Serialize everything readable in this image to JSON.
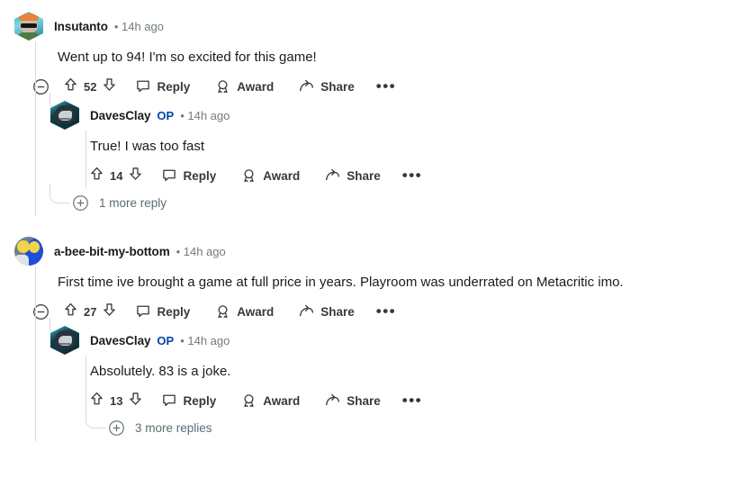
{
  "page": {
    "title": "Reddit comment thread",
    "accent_blue": "#0045ac",
    "text_color": "#181c1f",
    "meta_color": "#707b7f",
    "rail_color": "#d8dadc"
  },
  "labels": {
    "reply": "Reply",
    "award": "Award",
    "share": "Share",
    "more_dots": "•••"
  },
  "icons": {
    "collapse": "minus-circle-icon",
    "upvote": "upvote-arrow-icon",
    "downvote": "downvote-arrow-icon",
    "reply": "comment-bubble-icon",
    "award": "award-medal-icon",
    "share": "share-arrow-icon",
    "expand": "plus-circle-icon",
    "overflow": "overflow-menu-icon"
  },
  "comments": [
    {
      "id": "c1",
      "username": "Insutanto",
      "is_op": false,
      "op_label": "",
      "timestamp": "• 14h ago",
      "avatar": "dog-sunglasses-hex-avatar",
      "body": "Went up to 94! I'm so excited for this game!",
      "votes": "52",
      "reply": {
        "id": "c1r1",
        "username": "DavesClay",
        "is_op": true,
        "op_label": "OP",
        "timestamp": "• 14h ago",
        "avatar": "mech-helmet-hex-avatar",
        "body": "True! I was too fast",
        "votes": "14"
      },
      "more_replies": "1 more reply"
    },
    {
      "id": "c2",
      "username": "a-bee-bit-my-bottom",
      "is_op": false,
      "op_label": "",
      "timestamp": "• 14h ago",
      "avatar": "simpsons-circle-avatar",
      "body": "First time ive brought a game at full price in years. Playroom was underrated on Metacritic imo.",
      "votes": "27",
      "reply": {
        "id": "c2r1",
        "username": "DavesClay",
        "is_op": true,
        "op_label": "OP",
        "timestamp": "• 14h ago",
        "avatar": "mech-helmet-hex-avatar",
        "body": "Absolutely. 83 is a joke.",
        "votes": "13"
      },
      "more_replies": "3 more replies"
    }
  ]
}
